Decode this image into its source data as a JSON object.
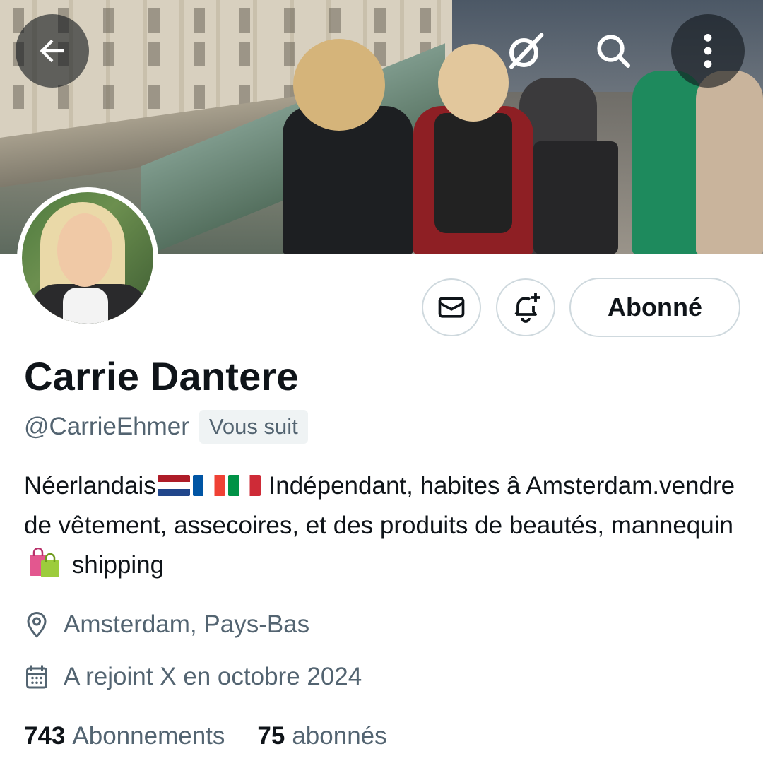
{
  "header": {
    "back_icon": "arrow-left-icon",
    "icons": [
      "grok-icon",
      "search-icon",
      "more-vertical-icon"
    ]
  },
  "profile": {
    "name": "Carrie Dantere",
    "handle": "@CarrieEhmer",
    "follows_you": "Vous suit",
    "bio_part1": "Néerlandais",
    "bio_flags": [
      "flag-netherlands",
      "flag-france",
      "flag-italy"
    ],
    "bio_part2": " Indépendant, habites â Amsterdam.vendre de vêtement, assecoires, et des produits de beautés, mannequin",
    "bio_emoji": "shopping-bags-icon",
    "bio_part3": " shipping",
    "location": "Amsterdam, Pays-Bas",
    "joined": "A rejoint X en octobre 2024"
  },
  "actions": {
    "message_icon": "envelope-icon",
    "notify_icon": "bell-plus-icon",
    "follow_label": "Abonné"
  },
  "stats": {
    "following_count": "743",
    "following_label": "Abonnements",
    "followers_count": "75",
    "followers_label": "abonnés"
  },
  "colors": {
    "text_primary": "#0f1419",
    "text_secondary": "#536471",
    "border": "#cfd9de",
    "badge_bg": "#eff3f4"
  }
}
